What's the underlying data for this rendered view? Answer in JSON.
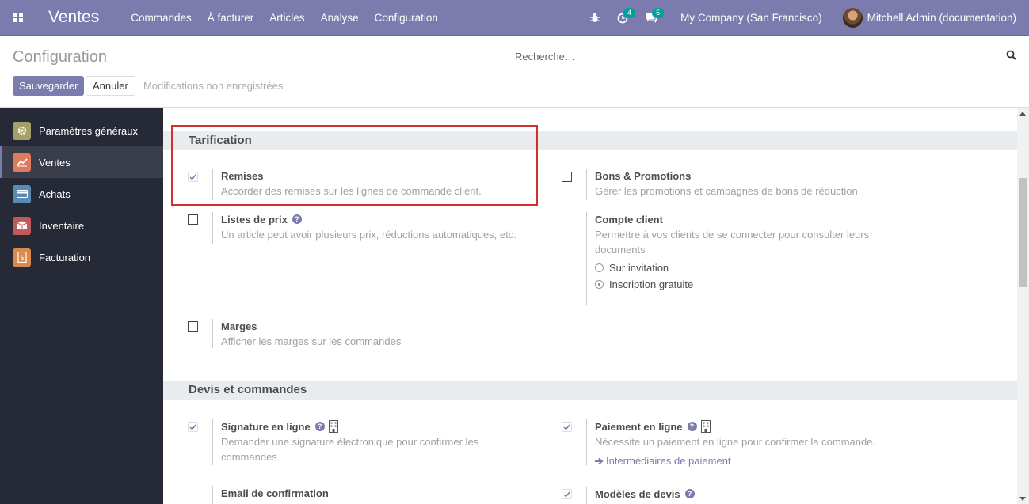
{
  "navbar": {
    "app_name": "Ventes",
    "menu": [
      "Commandes",
      "À facturer",
      "Articles",
      "Analyse",
      "Configuration"
    ],
    "activity_count": "4",
    "messages_count": "5",
    "company": "My Company (San Francisco)",
    "user": "Mitchell Admin (documentation)"
  },
  "control": {
    "title": "Configuration",
    "search_placeholder": "Recherche…",
    "save_label": "Sauvegarder",
    "cancel_label": "Annuler",
    "unsaved_label": "Modifications non enregistrées"
  },
  "sidebar": {
    "items": [
      {
        "label": "Paramètres généraux",
        "icon": "settings-icon",
        "color": "#a3a06a"
      },
      {
        "label": "Ventes",
        "icon": "sales-chart-icon",
        "color": "#e07a5f"
      },
      {
        "label": "Achats",
        "icon": "purchase-card-icon",
        "color": "#5b8bb0"
      },
      {
        "label": "Inventaire",
        "icon": "inventory-box-icon",
        "color": "#c05a5a"
      },
      {
        "label": "Facturation",
        "icon": "invoice-icon",
        "color": "#d98a4a"
      }
    ]
  },
  "sections": {
    "pricing": {
      "title": "Tarification",
      "discounts": {
        "title": "Remises",
        "desc": "Accorder des remises sur les lignes de commande client.",
        "checked": true
      },
      "coupons": {
        "title": "Bons & Promotions",
        "desc": "Gérer les promotions et campagnes de bons de réduction",
        "checked": false
      },
      "pricelists": {
        "title": "Listes de prix",
        "desc": "Un article peut avoir plusieurs prix, réductions automatiques, etc.",
        "checked": false
      },
      "customer_account": {
        "title": "Compte client",
        "desc": "Permettre à vos clients de se connecter pour consulter leurs documents",
        "option_invite": "Sur invitation",
        "option_free": "Inscription gratuite"
      },
      "margins": {
        "title": "Marges",
        "desc": "Afficher les marges sur les commandes",
        "checked": false
      }
    },
    "quotations": {
      "title": "Devis et commandes",
      "signature": {
        "title": "Signature en ligne",
        "desc": "Demander une signature électronique pour confirmer les commandes",
        "checked": true
      },
      "payment": {
        "title": "Paiement en ligne",
        "desc": "Nécessite un paiement en ligne pour confirmer la commande.",
        "link": "Intermédiaires de paiement",
        "checked": true
      },
      "confirmation_email": {
        "title": "Email de confirmation"
      },
      "templates": {
        "title": "Modèles de devis",
        "checked": true
      }
    }
  },
  "colors": {
    "brand": "#7c7bad",
    "sidebar": "#262a36",
    "highlight": "#d32f2f"
  }
}
